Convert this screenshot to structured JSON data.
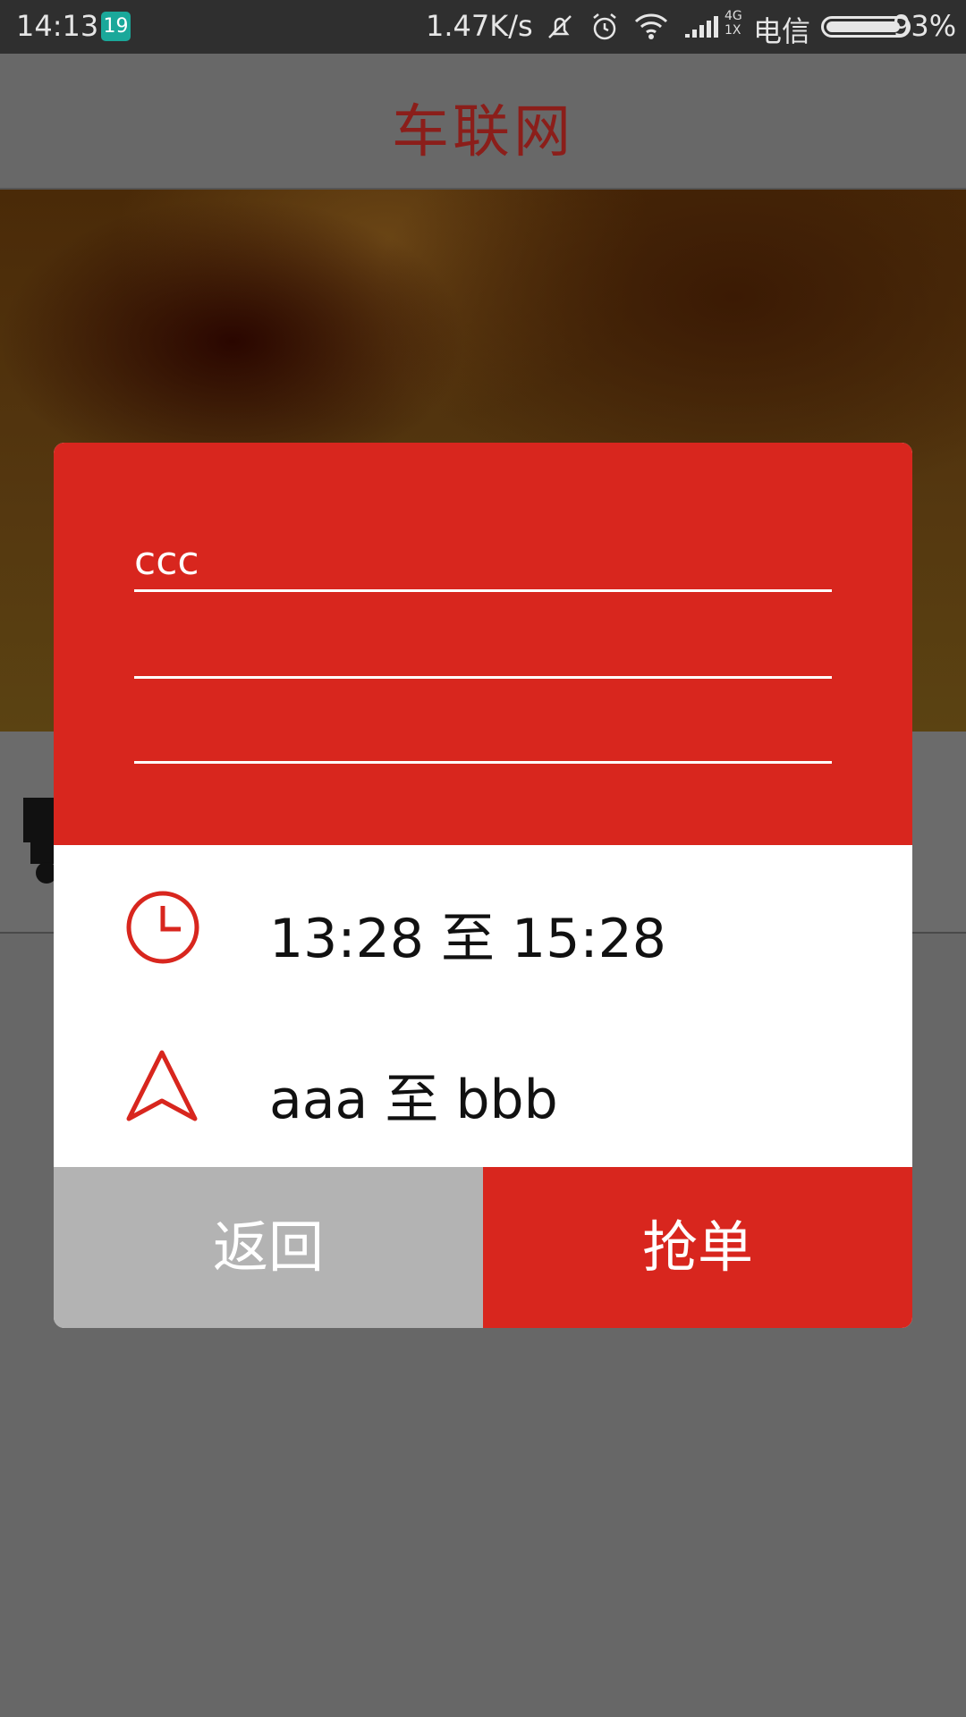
{
  "status_bar": {
    "time": "14:13",
    "notification_count": "19",
    "speed": "1.47K/s",
    "network_top": "4G",
    "network_bottom": "1X",
    "carrier": "电信",
    "battery_percent": "93%",
    "battery_level": 0.93
  },
  "app_bar": {
    "title": "车联网"
  },
  "dialog": {
    "fields": [
      {
        "value": "ccc",
        "placeholder": ""
      },
      {
        "value": "",
        "placeholder": ""
      },
      {
        "value": "",
        "placeholder": ""
      }
    ],
    "time_range": "13:28 至 15:28",
    "route": "aaa 至 bbb",
    "back_label": "返回",
    "grab_label": "抢单"
  },
  "colors": {
    "accent_red": "#d8261e",
    "title_red": "#8b1e1a",
    "back_gray": "#b3b3b3",
    "overlay": "#676767"
  },
  "icons": {
    "time": "clock-icon",
    "route": "navigation-arrow-icon",
    "list": "truck-icon"
  }
}
